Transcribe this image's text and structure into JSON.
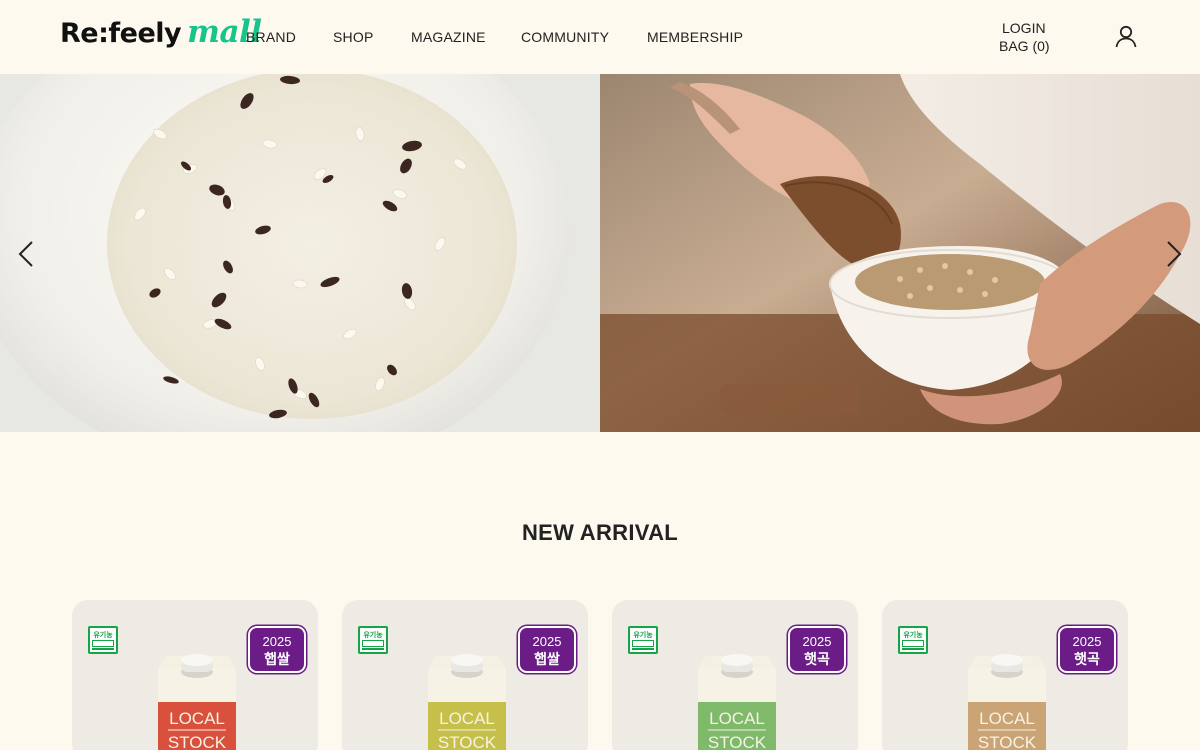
{
  "brand": {
    "logo_main": "Re:feely",
    "logo_sub": "mall"
  },
  "nav": {
    "brand": "BRAND",
    "shop": "SHOP",
    "magazine": "MAGAZINE",
    "community": "COMMUNITY",
    "membership": "MEMBERSHIP"
  },
  "account": {
    "login": "LOGIN",
    "bag": "BAG (0)"
  },
  "section": {
    "title": "NEW ARRIVAL"
  },
  "products": [
    {
      "organic_label": "유기농",
      "badge_year": "2025",
      "badge_text": "햅쌀",
      "product_line1": "LOCAL",
      "product_line2": "STOCK",
      "color": "#d9513c"
    },
    {
      "organic_label": "유기농",
      "badge_year": "2025",
      "badge_text": "햅쌀",
      "product_line1": "LOCAL",
      "product_line2": "STOCK",
      "color": "#c6c04a"
    },
    {
      "organic_label": "유기농",
      "badge_year": "2025",
      "badge_text": "햇곡",
      "product_line1": "LOCAL",
      "product_line2": "STOCK",
      "color": "#7fba6a"
    },
    {
      "organic_label": "유기농",
      "badge_year": "2025",
      "badge_text": "햇곡",
      "product_line1": "LOCAL",
      "product_line2": "STOCK",
      "color": "#caa474"
    }
  ],
  "colors": {
    "background": "#fdf9ee",
    "accent": "#17c48c",
    "badge": "#6b1c86",
    "card": "#eeeae4"
  },
  "icons": {
    "user": "user-icon",
    "prev": "chevron-left-icon",
    "next": "chevron-right-icon"
  }
}
